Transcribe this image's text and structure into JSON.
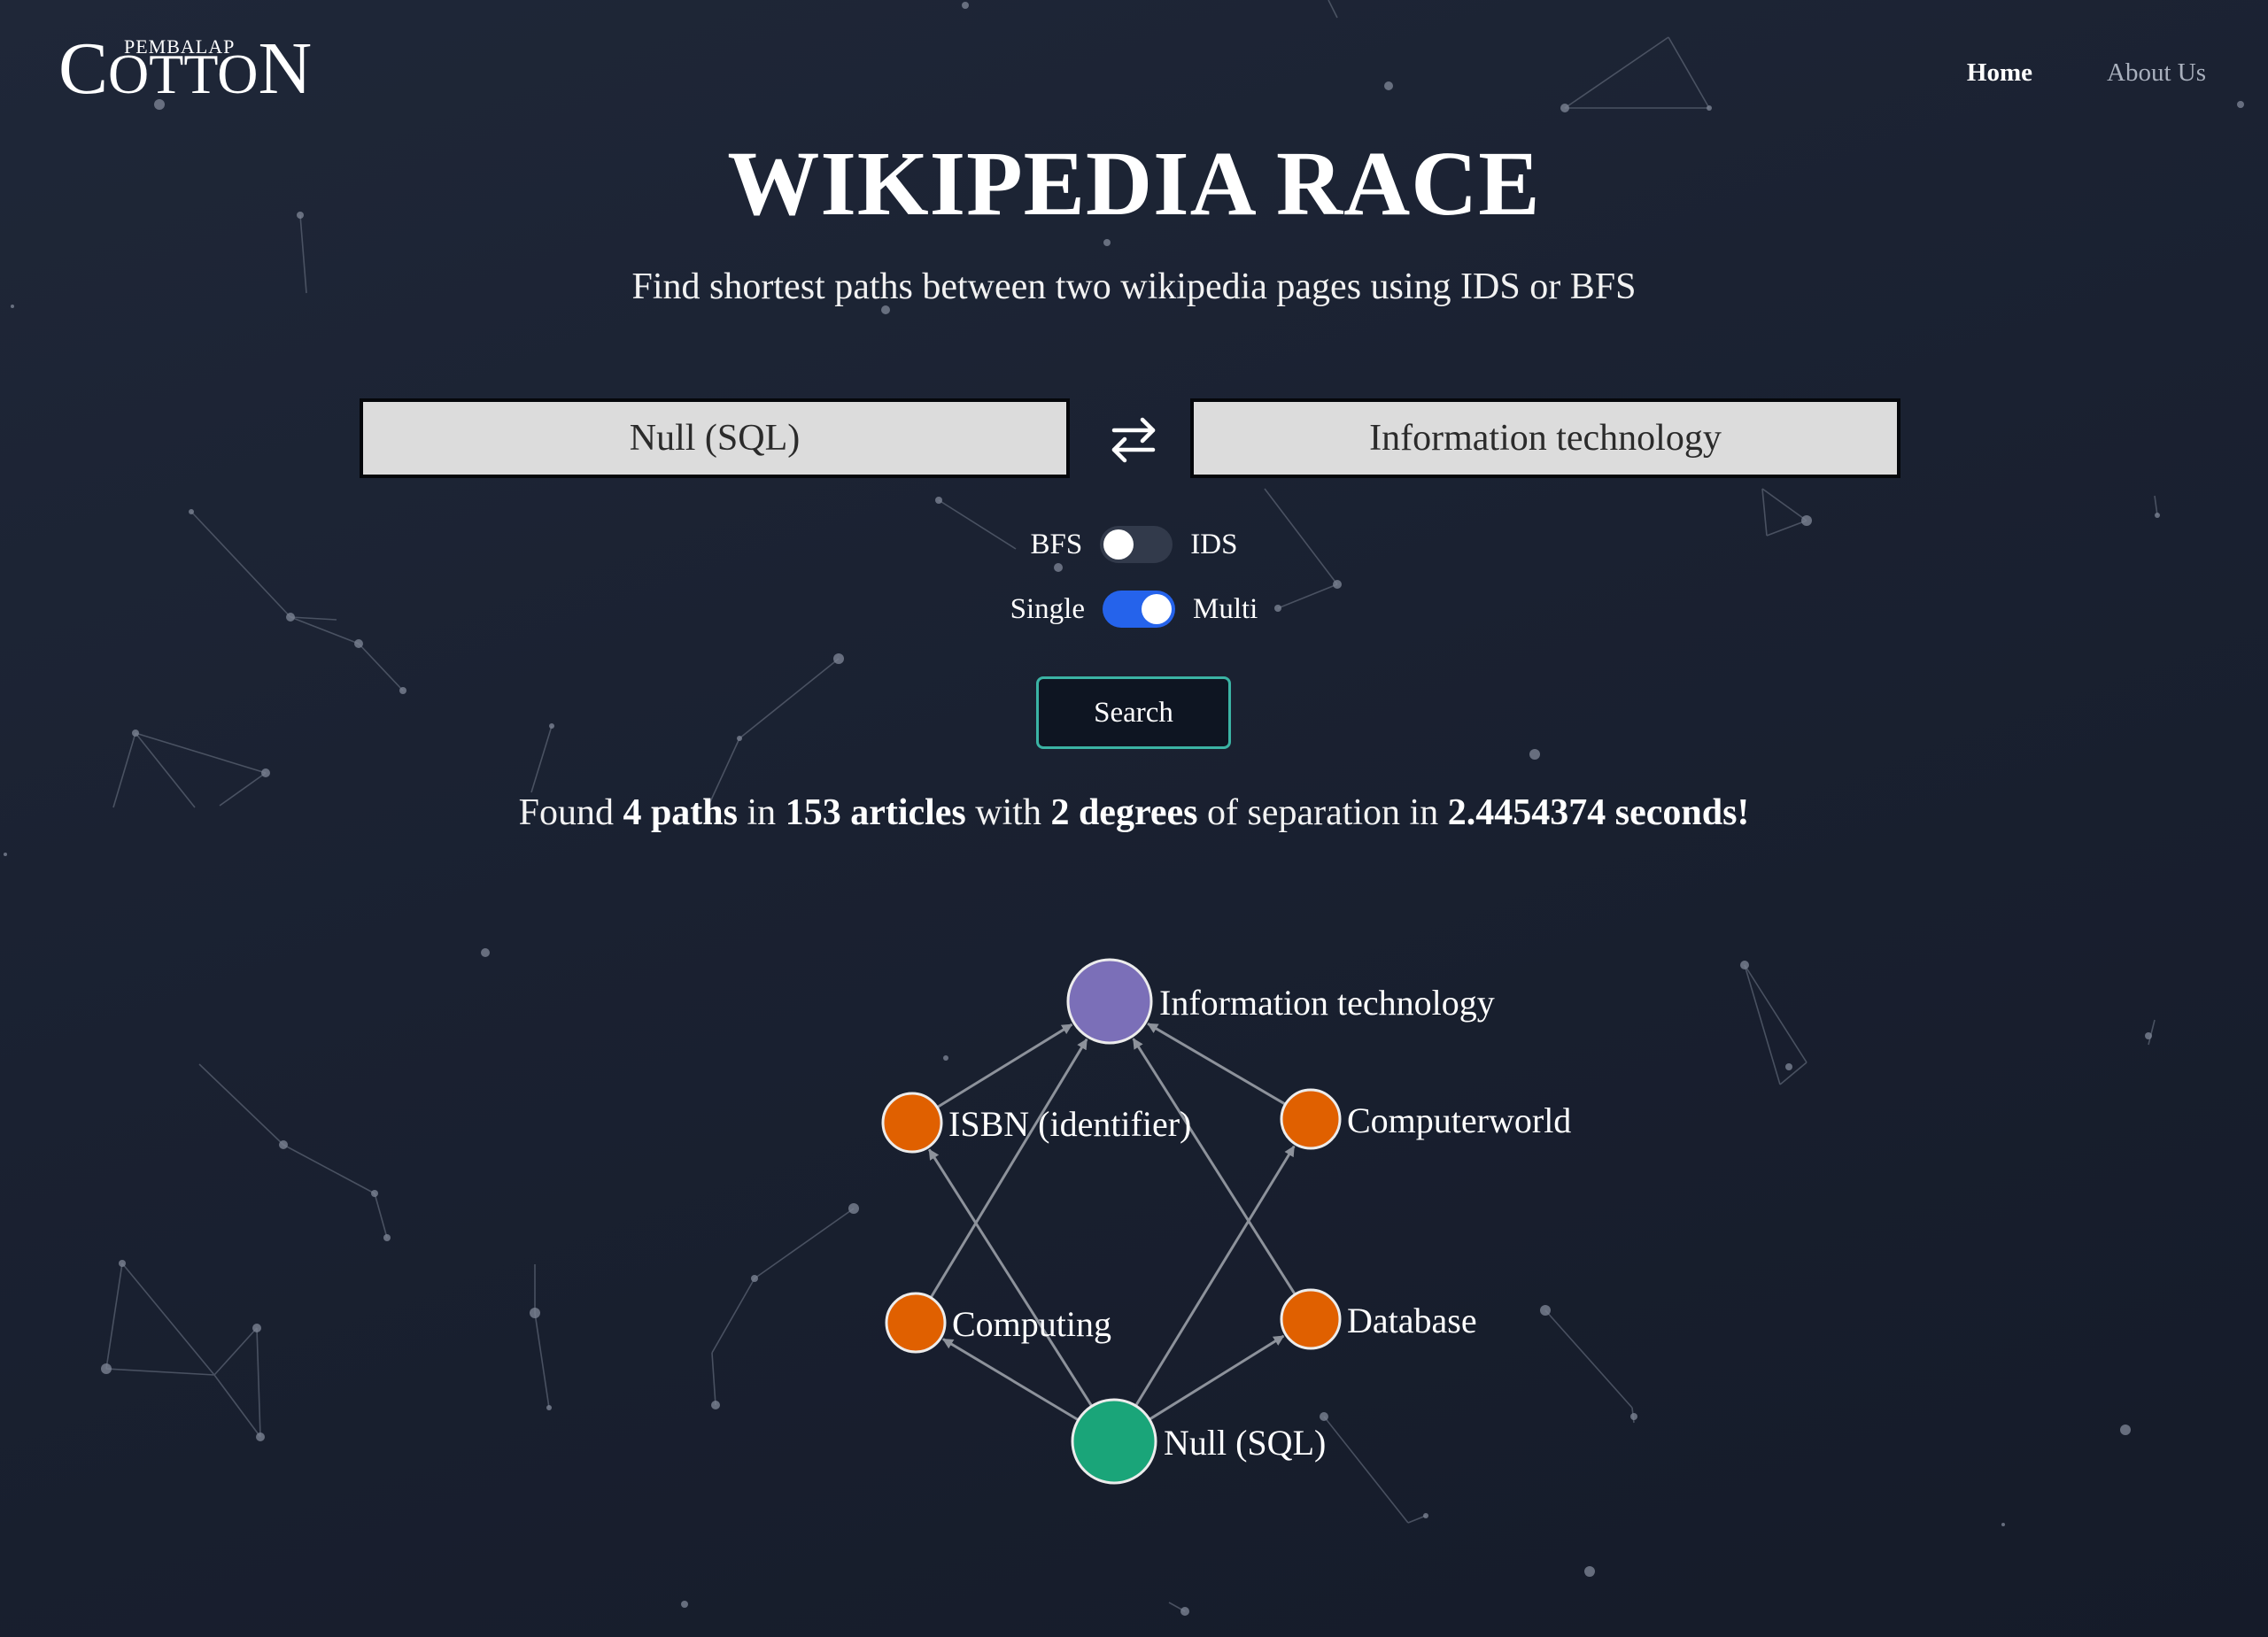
{
  "header": {
    "logo_small": "PEMBALAP",
    "logo_main": "COTTON"
  },
  "nav": {
    "home": "Home",
    "about": "About Us"
  },
  "hero": {
    "title": "WIKIPEDIA RACE",
    "subtitle": "Find shortest paths between two wikipedia pages using IDS or BFS"
  },
  "search": {
    "source_value": "Null (SQL)",
    "target_value": "Information technology",
    "swap_icon": "swap-arrows-icon",
    "algo_left": "BFS",
    "algo_right": "IDS",
    "algo_selected": "BFS",
    "mode_left": "Single",
    "mode_right": "Multi",
    "mode_selected": "Multi",
    "button_label": "Search"
  },
  "result": {
    "prefix": "Found",
    "paths": "4 paths",
    "in": "in",
    "articles": "153 articles",
    "with": "with",
    "degrees": "2 degrees",
    "of_sep": "of separation in",
    "seconds": "2.4454374 seconds!"
  },
  "graph": {
    "colors": {
      "target": "#7b6fb8",
      "source": "#1aa579",
      "intermediate": "#e06000",
      "edge": "#8d929b"
    },
    "nodes": [
      {
        "id": "it",
        "label": "Information technology",
        "role": "target"
      },
      {
        "id": "isbn",
        "label": "ISBN (identifier)",
        "role": "intermediate"
      },
      {
        "id": "cw",
        "label": "Computerworld",
        "role": "intermediate"
      },
      {
        "id": "comp",
        "label": "Computing",
        "role": "intermediate"
      },
      {
        "id": "db",
        "label": "Database",
        "role": "intermediate"
      },
      {
        "id": "null",
        "label": "Null (SQL)",
        "role": "source"
      }
    ],
    "edges": [
      [
        "null",
        "comp"
      ],
      [
        "null",
        "isbn"
      ],
      [
        "null",
        "cw"
      ],
      [
        "null",
        "db"
      ],
      [
        "comp",
        "it"
      ],
      [
        "isbn",
        "it"
      ],
      [
        "cw",
        "it"
      ],
      [
        "db",
        "it"
      ]
    ]
  }
}
